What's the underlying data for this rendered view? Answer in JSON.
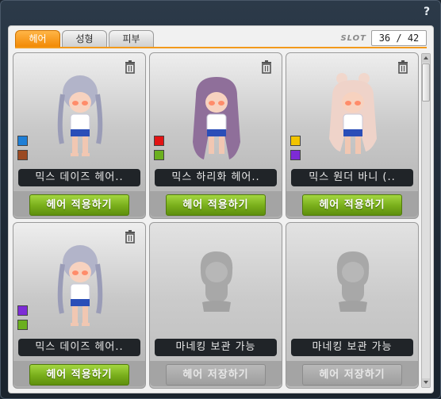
{
  "window": {
    "help_label": "?"
  },
  "tabs": [
    {
      "label": "헤어",
      "active": true
    },
    {
      "label": "성형",
      "active": false
    },
    {
      "label": "피부",
      "active": false
    }
  ],
  "slot": {
    "label": "SLOT",
    "value": "36 / 42"
  },
  "cards": [
    {
      "name": "믹스 데이즈 헤어..",
      "button": "헤어 적용하기",
      "empty": false,
      "colors": [
        "#1f7fd6",
        "#9b4a22"
      ],
      "hair": "silver"
    },
    {
      "name": "믹스 하리화 헤어..",
      "button": "헤어 적용하기",
      "empty": false,
      "colors": [
        "#e21414",
        "#6bb01e"
      ],
      "hair": "purple"
    },
    {
      "name": "믹스 원더 바니 (..",
      "button": "헤어 적용하기",
      "empty": false,
      "colors": [
        "#f2c400",
        "#7d2bd6"
      ],
      "hair": "pink"
    },
    {
      "name": "믹스 데이즈 헤어..",
      "button": "헤어 적용하기",
      "empty": false,
      "colors": [
        "#7d2bd6",
        "#6bb01e"
      ],
      "hair": "silver"
    },
    {
      "name": "마네킹 보관 가능",
      "button": "헤어 저장하기",
      "empty": true
    },
    {
      "name": "마네킹 보관 가능",
      "button": "헤어 저장하기",
      "empty": true
    }
  ],
  "colors": {
    "accent": "#f28a05",
    "apply_button": "#78ad1a",
    "name_bar": "#202428"
  }
}
